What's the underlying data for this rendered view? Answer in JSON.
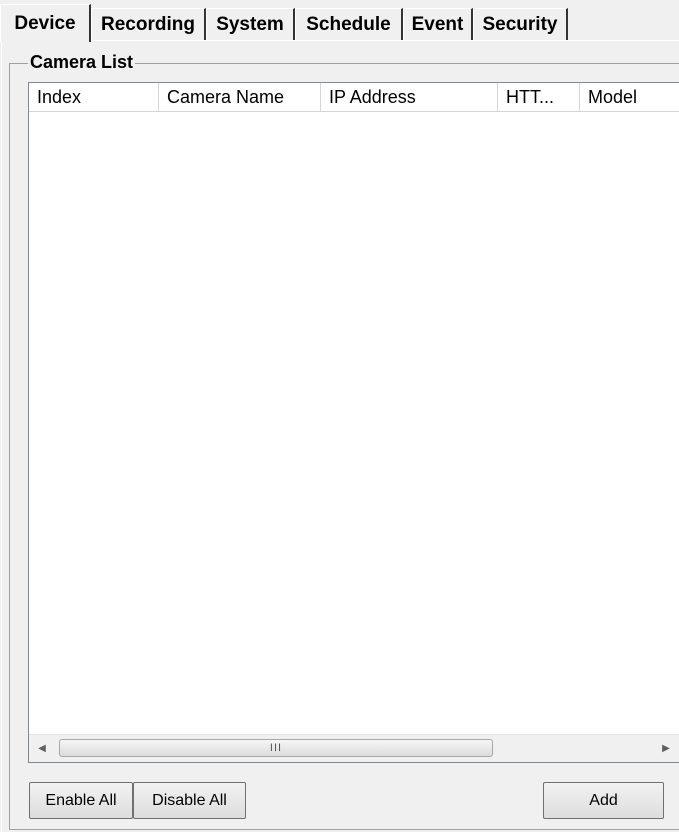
{
  "tabs": [
    {
      "label": "Device",
      "active": true
    },
    {
      "label": "Recording",
      "active": false
    },
    {
      "label": "System",
      "active": false
    },
    {
      "label": "Schedule",
      "active": false
    },
    {
      "label": "Event",
      "active": false
    },
    {
      "label": "Security",
      "active": false
    }
  ],
  "camera_list": {
    "title": "Camera List",
    "columns": [
      "Index",
      "Camera Name",
      "IP Address",
      "HTT...",
      "Model"
    ],
    "rows": [],
    "scrollbar_grip": "III"
  },
  "buttons": {
    "enable_all": "Enable All",
    "disable_all": "Disable All",
    "add": "Add"
  }
}
